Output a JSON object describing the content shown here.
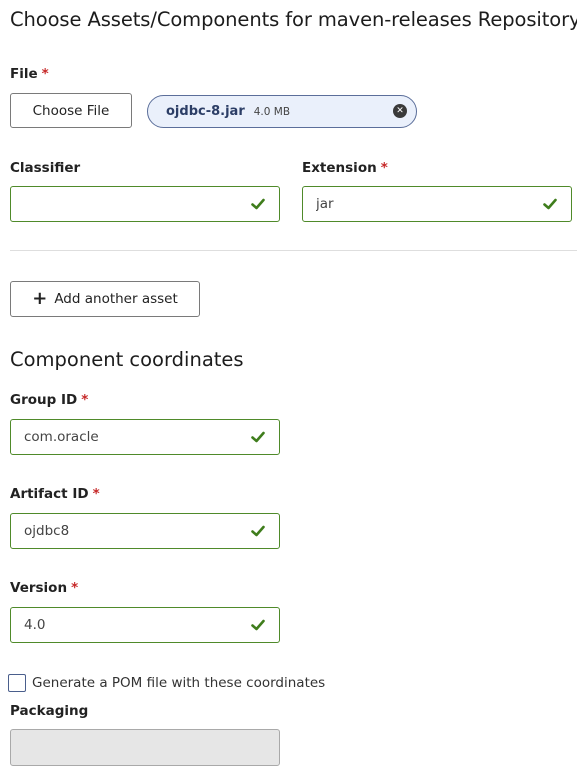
{
  "header": {
    "title": "Choose Assets/Components for maven-releases Repository"
  },
  "file": {
    "label": "File",
    "required_mark": "*",
    "choose_button": "Choose File",
    "selected_name": "ojdbc-8.jar",
    "selected_size": "4.0 MB"
  },
  "classifier": {
    "label": "Classifier",
    "value": ""
  },
  "extension": {
    "label": "Extension",
    "required_mark": "*",
    "value": "jar"
  },
  "add_asset": {
    "icon": "plus-icon",
    "label": "Add another asset"
  },
  "coordinates": {
    "heading": "Component coordinates",
    "group_id": {
      "label": "Group ID",
      "required_mark": "*",
      "value": "com.oracle"
    },
    "artifact_id": {
      "label": "Artifact ID",
      "required_mark": "*",
      "value": "ojdbc8"
    },
    "version": {
      "label": "Version",
      "required_mark": "*",
      "value": "4.0"
    }
  },
  "pom": {
    "checked": false,
    "label": "Generate a POM file with these coordinates"
  },
  "packaging": {
    "label": "Packaging",
    "value": "",
    "disabled": true
  },
  "colors": {
    "valid_border": "#4f8a2a",
    "required": "#c62828",
    "chip_bg": "#eaf0fb"
  }
}
